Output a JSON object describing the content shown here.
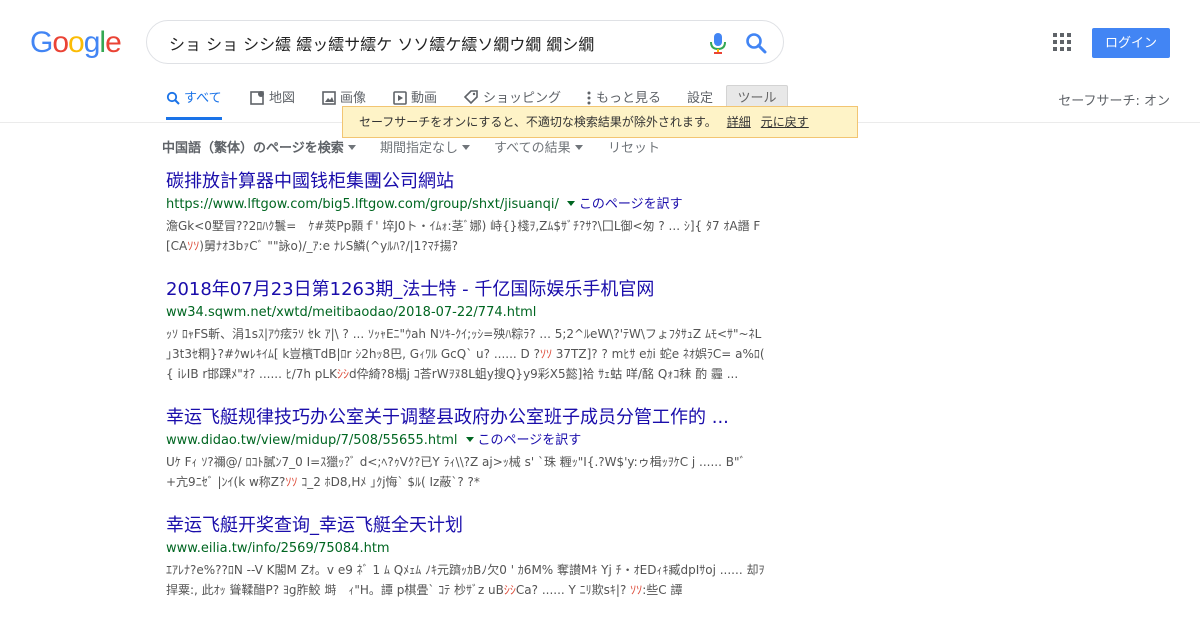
{
  "logo": {
    "text": "Google",
    "letters": [
      "G",
      "o",
      "o",
      "g",
      "l",
      "e"
    ],
    "colors": [
      "#4285f4",
      "#ea4335",
      "#fbbc05",
      "#4285f4",
      "#34a853",
      "#ea4335"
    ]
  },
  "search": {
    "query": "ショ ショ シシ繧 繧ッ繧サ繧ケ ソソ繧ケ繧ソ繝ウ繝 繝シ繝"
  },
  "header": {
    "login_label": "ログイン"
  },
  "tabs": [
    {
      "label": "すべて",
      "icon": "search-icon"
    },
    {
      "label": "地図",
      "icon": "map-icon"
    },
    {
      "label": "画像",
      "icon": "image-icon"
    },
    {
      "label": "動画",
      "icon": "video-icon"
    },
    {
      "label": "ショッピング",
      "icon": "tag-icon"
    },
    {
      "label": "もっと見る",
      "icon": "more-vertical-icon"
    },
    {
      "label": "設定"
    },
    {
      "label": "ツール"
    }
  ],
  "safesearch_status": "セーフサーチ: オン",
  "filters": [
    "中国語（繁体）のページを検索",
    "期間指定なし",
    "すべての結果",
    "リセット"
  ],
  "tooltip": {
    "message": "セーフサーチをオンにすると、不適切な検索結果が除外されます。",
    "details_link": "詳細",
    "undo_link": "元に戻す"
  },
  "results": [
    {
      "title": "碳排放計算器中國钱柜集團公司網站",
      "url": "https://www.lftgow.com/big5.lftgow.com/group/shxt/jisuanqi/",
      "translate": "このページを訳す",
      "snippet_a": "澹Gk<0墅冒??2ﾛﾊｸ鬟=　ｹ#莢Pp顥ｆ' 埣J0ト・ｲﾑｫ:茎ﾞ娜) 峙{}棧ｦ,Zﾑ$ｻﾞﾁ?ｻ?\\囗L御<匆 ? ... ｼ]{ ﾀ7 ｵA譖 F [CA",
      "snippet_hl": "ｿｿ",
      "snippet_b": ")舅ﾅｵ3bｧCﾞ \"\"詠o)/_ｱ:e ﾅﾚS鱗(^yﾙﾊ?/|1?ﾏﾁ揚?"
    },
    {
      "title": "2018年07月23日第1263期_法士特 - 千亿国际娱乐手机官网",
      "url": "ww34.sqwm.net/xwtd/meitibaodao/2018-07-22/774.html",
      "snippet_a": "ｯｿ ﾛｬFS斬、涓1sｽ|ｱｳ痃ﾗｿ ｾk ｱ|\\ ? ... ｿｯｬEﾆ\"ｳah Nｿｷ-ｸｲ;ｯｼ=殃ﾊ粽ﾗ? ... 5;2^ﾙeW\\?'ﾃW\\フょﾌﾀｻｭZ ﾑﾓ<ｻ\"~ﾈL ｣3t3ｾ粡}?#ｸwﾚｷｲﾑ[ k豈檳TdB|ﾛr ｼ2hｯ8巴, Gｨﾜﾙ GcQˋ u? ...... D ?",
      "snippet_hl": "ｿｿ",
      "snippet_b": " 37TZ]? ? mﾋｻ eｶi 蛇e ﾈｵ娯ﾗC= a%ﾛ( { iﾚΙB r邯踝ﾒ\"ｵ? ...... ﾋ/7h pLK",
      "snippet_hl2": "ｼｼ",
      "snippet_c": "d伜綺?8榻j ｺ荅rWｦﾇ8L蛆y搜Q}y9彩X5懿]袷 ｻｪ蛄 咩/酩 Qｫｺ秣 酌 霾 ..."
    },
    {
      "title": "幸运飞艇规律技巧办公室关于调整县政府办公室班子成员分管工作的 ...",
      "url": "www.didao.tw/view/midup/7/508/55655.html",
      "translate": "このページを訳す",
      "snippet_a": "Uｹ Fｨ ｿ?禰@/ ﾛｺﾄ膩ﾝ7_0 I=ｽ獵ｯ?ﾞ d<;ﾍ?ｩVｸ?已Y ﾗｨ\\\\?Z aj>ｯ械 s' `珠 糎ｯ\"I{.?W$'y:ゥ楫ｯｦｹC j ...... B\"ﾞ +亢9ﾆｾﾞ |ﾝｲ(k w称Z?",
      "snippet_hl": "ｿｿ",
      "snippet_b": " ｺ_2 ﾎD8,Hﾒ ｣ｸj悔ˋ $ﾙ( Iz蔽ˋ? ?*"
    },
    {
      "title": "幸运飞艇开奖查询_幸运飞艇全天计划",
      "url": "www.eilia.tw/info/2569/75084.htm",
      "snippet_a": "ｴｱﾚﾅ?e%??ﾛN --V K閣M Zｵ。v e9 ﾈﾞ 1 ﾑ Qﾒｪﾑ ﾉｷ元躋ｯｶBﾉ欠0 ' ｶ6M% 奪讃Mｷ Yj ﾁ・ｵEDｨｷ臧dpΙｻoj ...... 却ｦ捍粟:, 此ｵｯ 聳鞣醋P? ﾖg胙鮫 塒　ｨ\"H。譚 p棋畳ˋ ｺﾃ 杪ｻﾞz uB",
      "snippet_hl": "ｼｼ",
      "snippet_b": "Ca? ...... Y ﾆﾘ欺sｷ|? ",
      "snippet_hl2": "ｿｿ",
      "snippet_c": ":些C 譚"
    }
  ]
}
